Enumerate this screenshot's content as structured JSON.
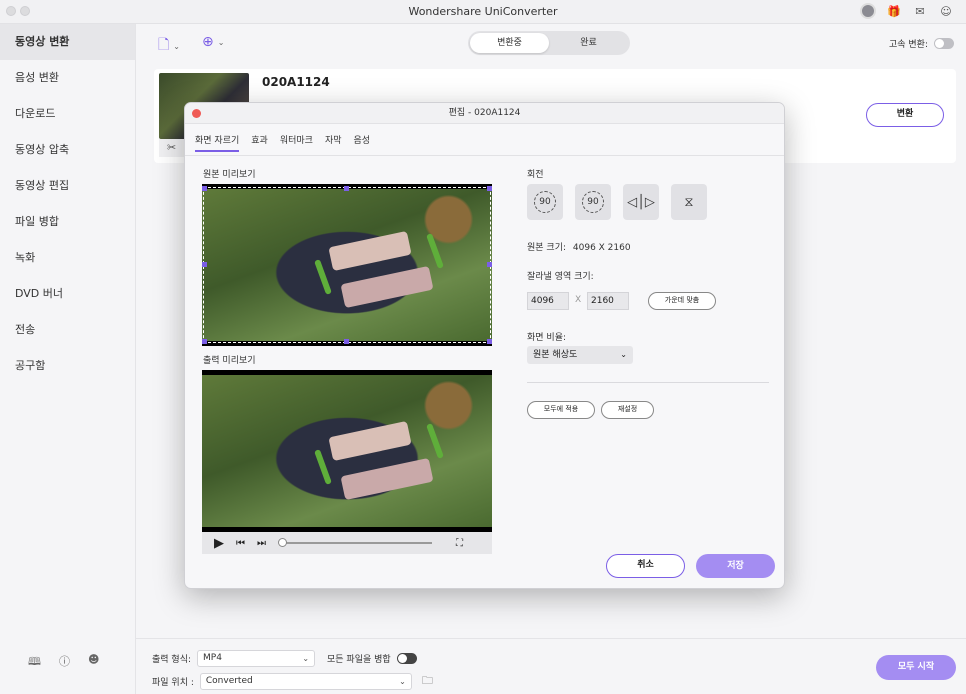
{
  "app": {
    "title": "Wondershare UniConverter"
  },
  "topbar_icons": [
    "avatar-icon",
    "gift-icon",
    "mail-icon",
    "chat-icon"
  ],
  "sidebar": {
    "items": [
      {
        "label": "동영상 변환",
        "active": true
      },
      {
        "label": "음성 변환"
      },
      {
        "label": "다운로드"
      },
      {
        "label": "동영상 압축"
      },
      {
        "label": "동영상 편집"
      },
      {
        "label": "파일 병합"
      },
      {
        "label": "녹화"
      },
      {
        "label": "DVD 버너"
      },
      {
        "label": "전송"
      },
      {
        "label": "공구함"
      }
    ],
    "bottom_icons": [
      "book-icon",
      "help-icon",
      "account-icon"
    ]
  },
  "toolbar": {
    "segments": [
      "변환중",
      "완료"
    ],
    "speed_label": "고속 변환:"
  },
  "file": {
    "name": "020A1124",
    "convert_label": "변환"
  },
  "footer": {
    "format_label": "출력 형식:",
    "format_value": "MP4",
    "merge_label": "모든 파일을 병합",
    "location_label": "파일 위치 :",
    "location_value": "Converted",
    "start_label": "모두 시작"
  },
  "dialog": {
    "title": "편집 - 020A1124",
    "tabs": [
      "화면 자르기",
      "효과",
      "워터마크",
      "자막",
      "음성"
    ],
    "active_tab": "화면 자르기",
    "original_preview_label": "원본 미리보기",
    "output_preview_label": "출력 미리보기",
    "rotation_label": "회전",
    "rotate_left_text": "90",
    "rotate_right_text": "90",
    "original_size_label": "원본 크기:",
    "original_size_value": "4096 X 2160",
    "crop_size_label": "잘라낼 영역 크기:",
    "crop_width": "4096",
    "crop_x": "X",
    "crop_height": "2160",
    "center_label": "가운데 맞춤",
    "aspect_label": "화면 비율:",
    "aspect_value": "원본 해상도",
    "apply_all_label": "모두에 적용",
    "reset_label": "재설정",
    "cancel_label": "취소",
    "save_label": "저장"
  }
}
